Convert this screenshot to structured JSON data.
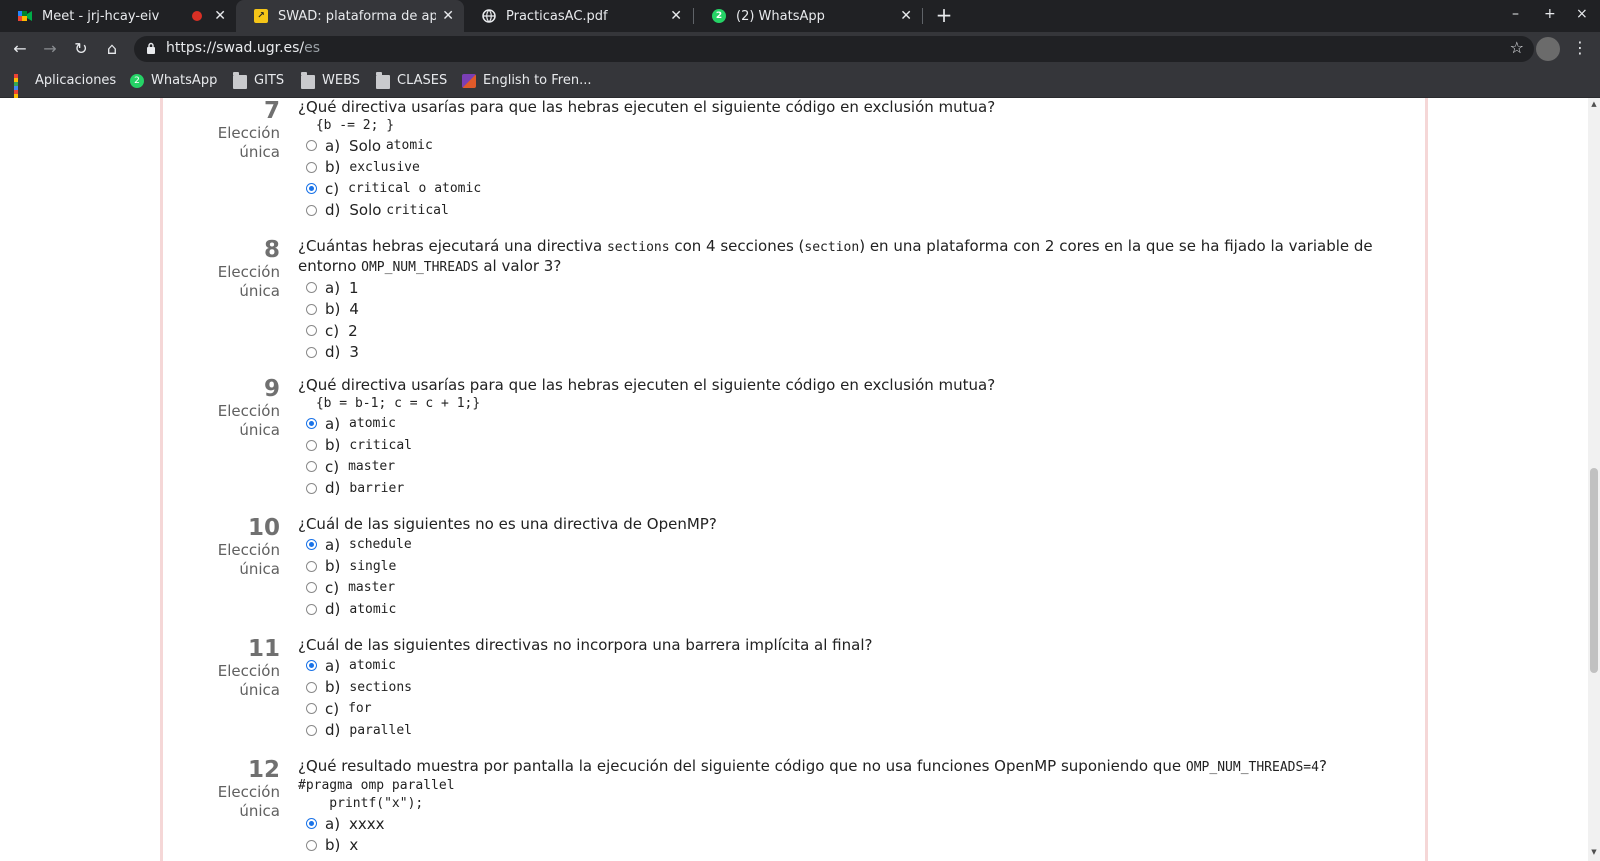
{
  "tabs": [
    {
      "title": "Meet - jrj-hcay-eiv",
      "favicon": "meet-icon",
      "active": false,
      "recording": true
    },
    {
      "title": "SWAD: plataforma de apoyo",
      "favicon": "swad-icon",
      "active": true
    },
    {
      "title": "PracticasAC.pdf",
      "favicon": "globe-icon",
      "active": false
    },
    {
      "title": "(2) WhatsApp",
      "favicon": "whatsapp-icon",
      "active": false
    }
  ],
  "window_controls": {
    "minimize": "–",
    "maximize": "+",
    "close": "×"
  },
  "address_bar": {
    "host": "https://swad.ugr.es/",
    "path": "es"
  },
  "bookmarks": [
    {
      "label": "Aplicaciones",
      "icon": "apps-grid-icon"
    },
    {
      "label": "WhatsApp",
      "icon": "whatsapp-icon"
    },
    {
      "label": "GITS",
      "icon": "folder-icon"
    },
    {
      "label": "WEBS",
      "icon": "folder-icon"
    },
    {
      "label": "CLASES",
      "icon": "folder-icon"
    },
    {
      "label": "English to Fren...",
      "icon": "reverso-icon"
    }
  ],
  "question_type": [
    "Elección",
    "única"
  ],
  "questions": [
    {
      "number": "7",
      "stem": "¿Qué directiva usarías para que las hebras ejecuten el siguiente código en exclusión mutua?",
      "code": " {b -= 2; }",
      "options": [
        {
          "letter": "a)",
          "text": "Solo ",
          "code": "atomic",
          "checked": false
        },
        {
          "letter": "b)",
          "text": "",
          "code": "exclusive",
          "checked": false
        },
        {
          "letter": "c)",
          "text": "",
          "code": "critical o atomic",
          "checked": true
        },
        {
          "letter": "d)",
          "text": "Solo ",
          "code": "critical",
          "checked": false
        }
      ]
    },
    {
      "number": "8",
      "stem_parts": [
        "¿Cuántas hebras ejecutará una directiva ",
        "sections",
        " con 4 secciones (",
        "section",
        ") en una plataforma con 2 cores en la que se ha fijado la variable de entorno ",
        "OMP_NUM_THREADS",
        " al valor 3?"
      ],
      "options": [
        {
          "letter": "a)",
          "text": "1",
          "checked": false
        },
        {
          "letter": "b)",
          "text": "4",
          "checked": false
        },
        {
          "letter": "c)",
          "text": "2",
          "checked": false
        },
        {
          "letter": "d)",
          "text": "3",
          "checked": false
        }
      ]
    },
    {
      "number": "9",
      "stem": "¿Qué directiva usarías para que las hebras ejecuten el siguiente código en exclusión mutua?",
      "code": " {b = b-1; c = c + 1;}",
      "options": [
        {
          "letter": "a)",
          "code": "atomic",
          "checked": true
        },
        {
          "letter": "b)",
          "code": "critical",
          "checked": false
        },
        {
          "letter": "c)",
          "code": "master",
          "checked": false
        },
        {
          "letter": "d)",
          "code": "barrier",
          "checked": false
        }
      ]
    },
    {
      "number": "10",
      "stem": "¿Cuál de las siguientes no es una directiva de OpenMP?",
      "options": [
        {
          "letter": "a)",
          "code": "schedule",
          "checked": true
        },
        {
          "letter": "b)",
          "code": "single",
          "checked": false
        },
        {
          "letter": "c)",
          "code": "master",
          "checked": false
        },
        {
          "letter": "d)",
          "code": "atomic",
          "checked": false
        }
      ]
    },
    {
      "number": "11",
      "stem": "¿Cuál de las siguientes directivas no incorpora una barrera implícita al final?",
      "options": [
        {
          "letter": "a)",
          "code": "atomic",
          "checked": true
        },
        {
          "letter": "b)",
          "code": "sections",
          "checked": false
        },
        {
          "letter": "c)",
          "code": "for",
          "checked": false
        },
        {
          "letter": "d)",
          "code": "parallel",
          "checked": false
        }
      ]
    },
    {
      "number": "12",
      "stem_parts": [
        "¿Qué resultado muestra por pantalla la ejecución del siguiente código que no usa funciones OpenMP suponiendo que ",
        "OMP_NUM_THREADS=4",
        "?"
      ],
      "code": "#pragma omp parallel\n    printf(\"x\");",
      "options": [
        {
          "letter": "a)",
          "text": "xxxx",
          "checked": true
        },
        {
          "letter": "b)",
          "text": "x",
          "checked": false
        }
      ]
    }
  ],
  "colors": {
    "accent": "#1a73e8",
    "chrome_dark": "#202124",
    "chrome": "#35363a",
    "sheet_border": "#f5d7d7"
  }
}
